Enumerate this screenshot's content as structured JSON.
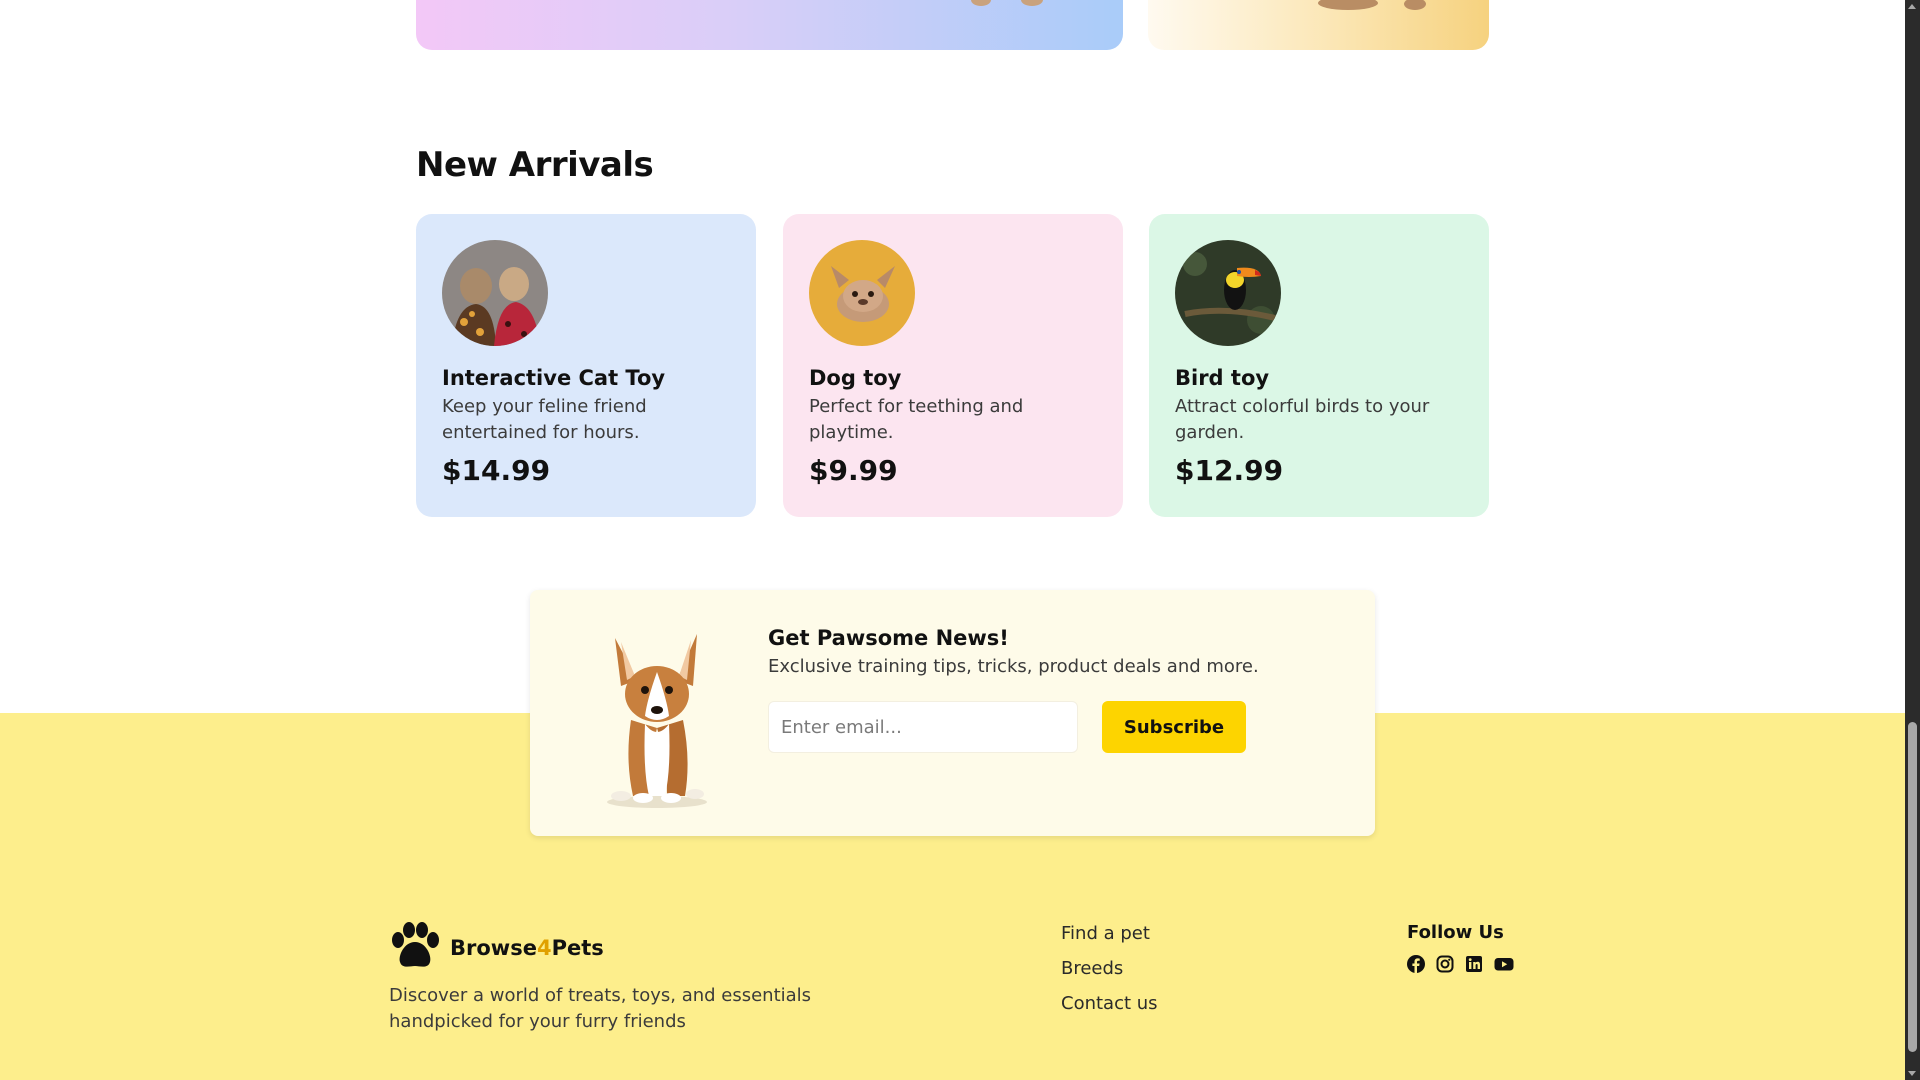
{
  "new_arrivals": {
    "title": "New Arrivals",
    "products": [
      {
        "name": "Interactive Cat Toy",
        "description": "Keep your feline friend entertained for hours.",
        "price": "$14.99",
        "bg": "#dbe8fb"
      },
      {
        "name": "Dog toy",
        "description": "Perfect for teething and playtime.",
        "price": "$9.99",
        "bg": "#fce5f0"
      },
      {
        "name": "Bird toy",
        "description": "Attract colorful birds to your garden.",
        "price": "$12.99",
        "bg": "#dbf7e6"
      }
    ]
  },
  "newsletter": {
    "title": "Get Pawsome News!",
    "subtitle": "Exclusive training tips, tricks, product deals and more.",
    "email_placeholder": "Enter email...",
    "subscribe_label": "Subscribe"
  },
  "footer": {
    "brand_prefix": "Browse",
    "brand_four": "4",
    "brand_suffix": "Pets",
    "description": "Discover a world of treats, toys, and essentials handpicked for your furry friends",
    "links": [
      "Find a pet",
      "Breeds",
      "Contact us"
    ],
    "follow_heading": "Follow Us",
    "social_icons": [
      "facebook-icon",
      "instagram-icon",
      "linkedin-icon",
      "youtube-icon"
    ]
  },
  "colors": {
    "footer_bg": "#fdee8c",
    "accent_yellow": "#fdd400",
    "newsletter_bg": "#fefbe9"
  }
}
